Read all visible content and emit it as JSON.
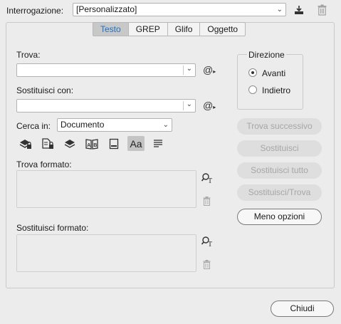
{
  "query": {
    "label": "Interrogazione:",
    "value": "[Personalizzato]",
    "save_icon": "save-query-icon",
    "delete_icon": "trash-icon"
  },
  "tabs": [
    {
      "label": "Testo",
      "active": true
    },
    {
      "label": "GREP",
      "active": false
    },
    {
      "label": "Glifo",
      "active": false
    },
    {
      "label": "Oggetto",
      "active": false
    }
  ],
  "find": {
    "label": "Trova:",
    "value": "",
    "special_icon": "at-special-chars-icon"
  },
  "replace": {
    "label": "Sostituisci con:",
    "value": "",
    "special_icon": "at-special-chars-icon"
  },
  "search_in": {
    "label": "Cerca in:",
    "value": "Documento"
  },
  "options": [
    {
      "icon": "locked-layers-icon",
      "selected": false
    },
    {
      "icon": "locked-stories-icon",
      "selected": false
    },
    {
      "icon": "hidden-layers-icon",
      "selected": false
    },
    {
      "icon": "master-pages-icon",
      "selected": false
    },
    {
      "icon": "footnotes-icon",
      "selected": false
    },
    {
      "icon": "case-sensitive-icon",
      "text": "Aa",
      "selected": true
    },
    {
      "icon": "whole-word-icon",
      "selected": false
    }
  ],
  "find_format": {
    "label": "Trova formato:"
  },
  "replace_format": {
    "label": "Sostituisci formato:"
  },
  "direction": {
    "title": "Direzione",
    "options": [
      {
        "label": "Avanti",
        "checked": true
      },
      {
        "label": "Indietro",
        "checked": false
      }
    ]
  },
  "buttons": {
    "find_next": "Trova successivo",
    "replace": "Sostituisci",
    "replace_all": "Sostituisci tutto",
    "replace_find": "Sostituisci/Trova",
    "fewer_options": "Meno opzioni",
    "close": "Chiudi"
  }
}
